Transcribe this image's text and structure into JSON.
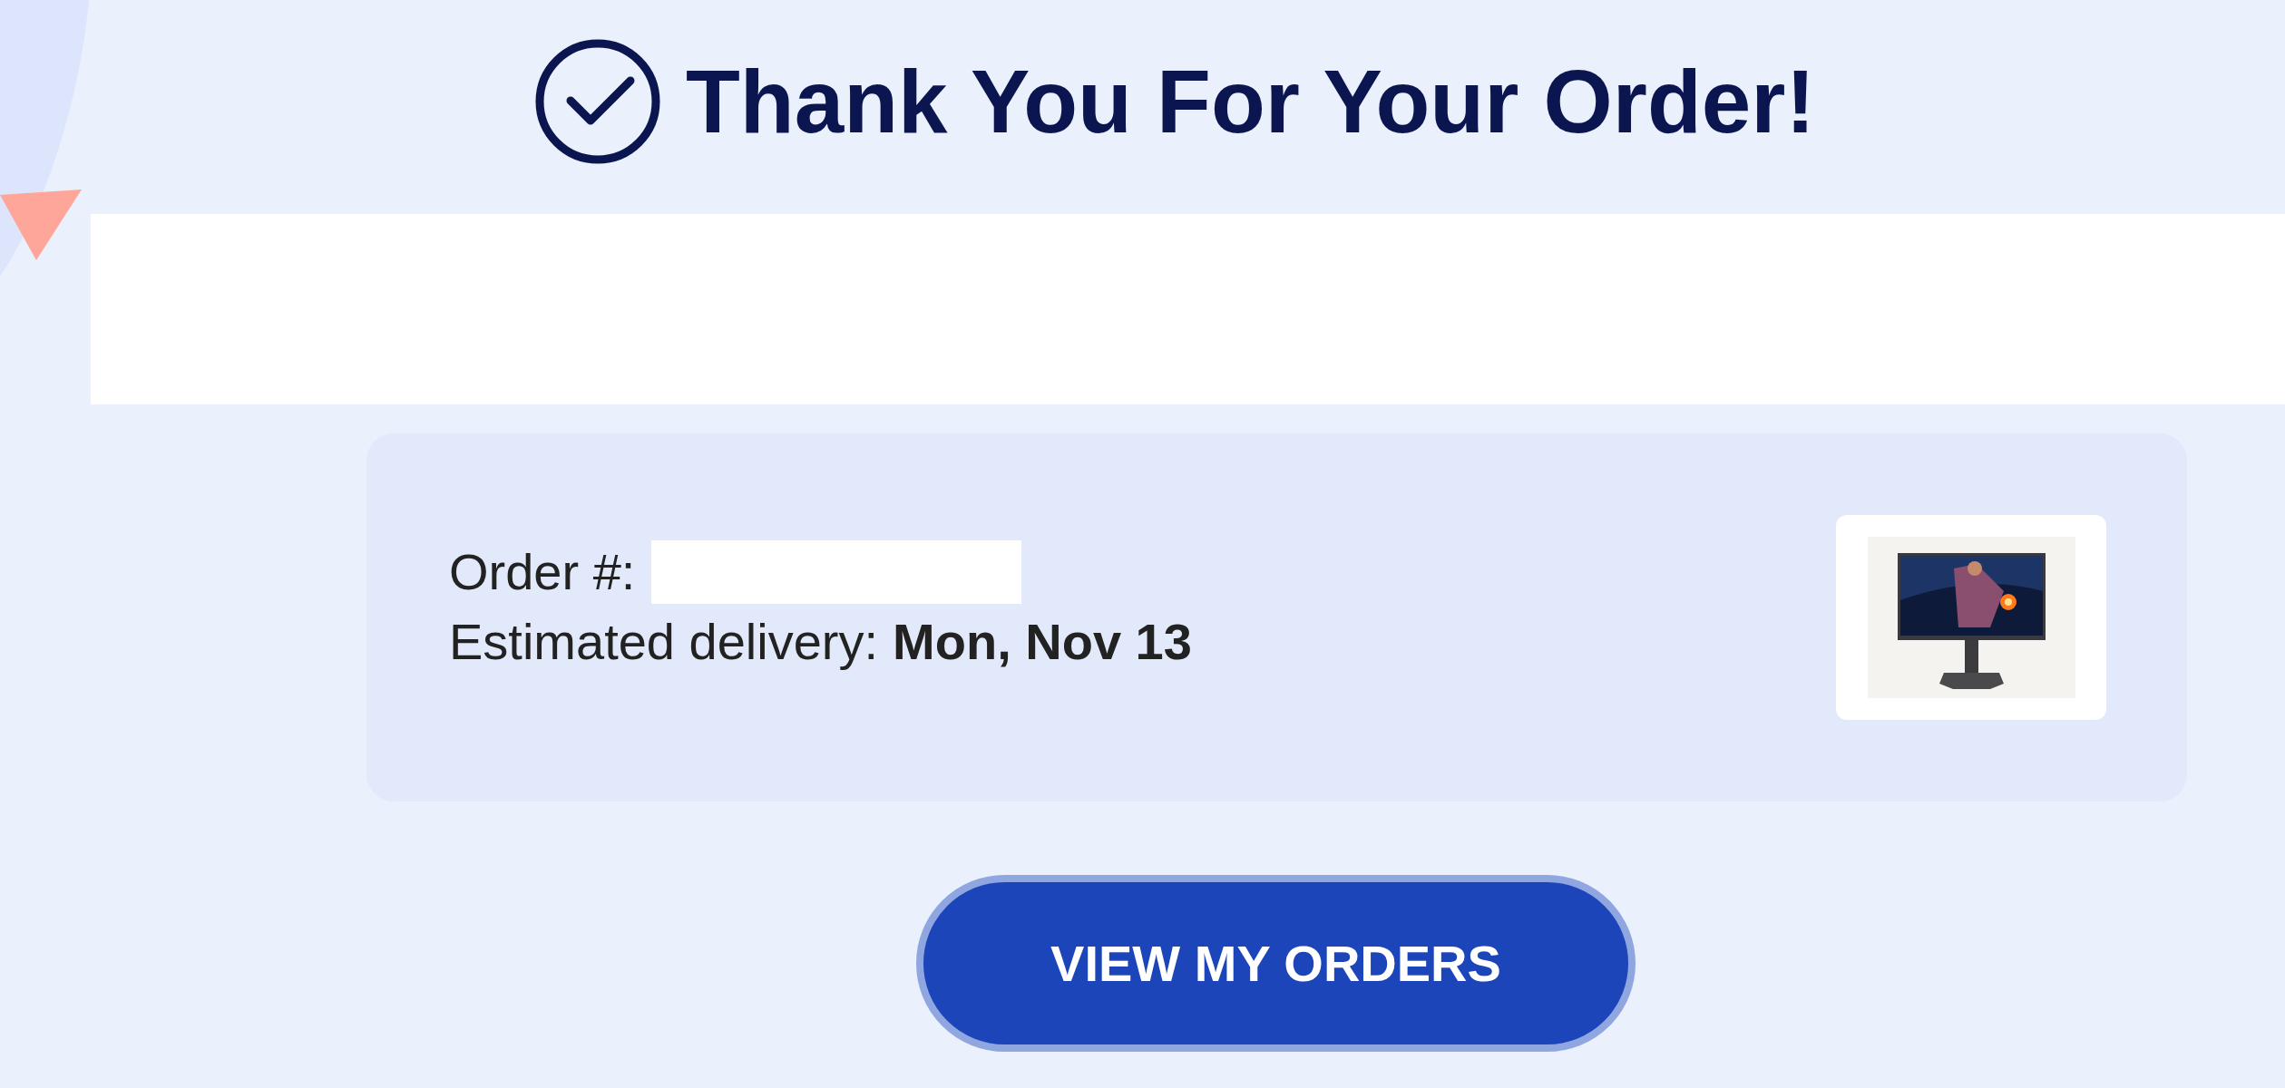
{
  "title": "Thank You For Your Order!",
  "order": {
    "number_label": "Order #:",
    "delivery_label": "Estimated delivery:",
    "delivery_date": "Mon, Nov 13"
  },
  "button": "VIEW MY ORDERS"
}
